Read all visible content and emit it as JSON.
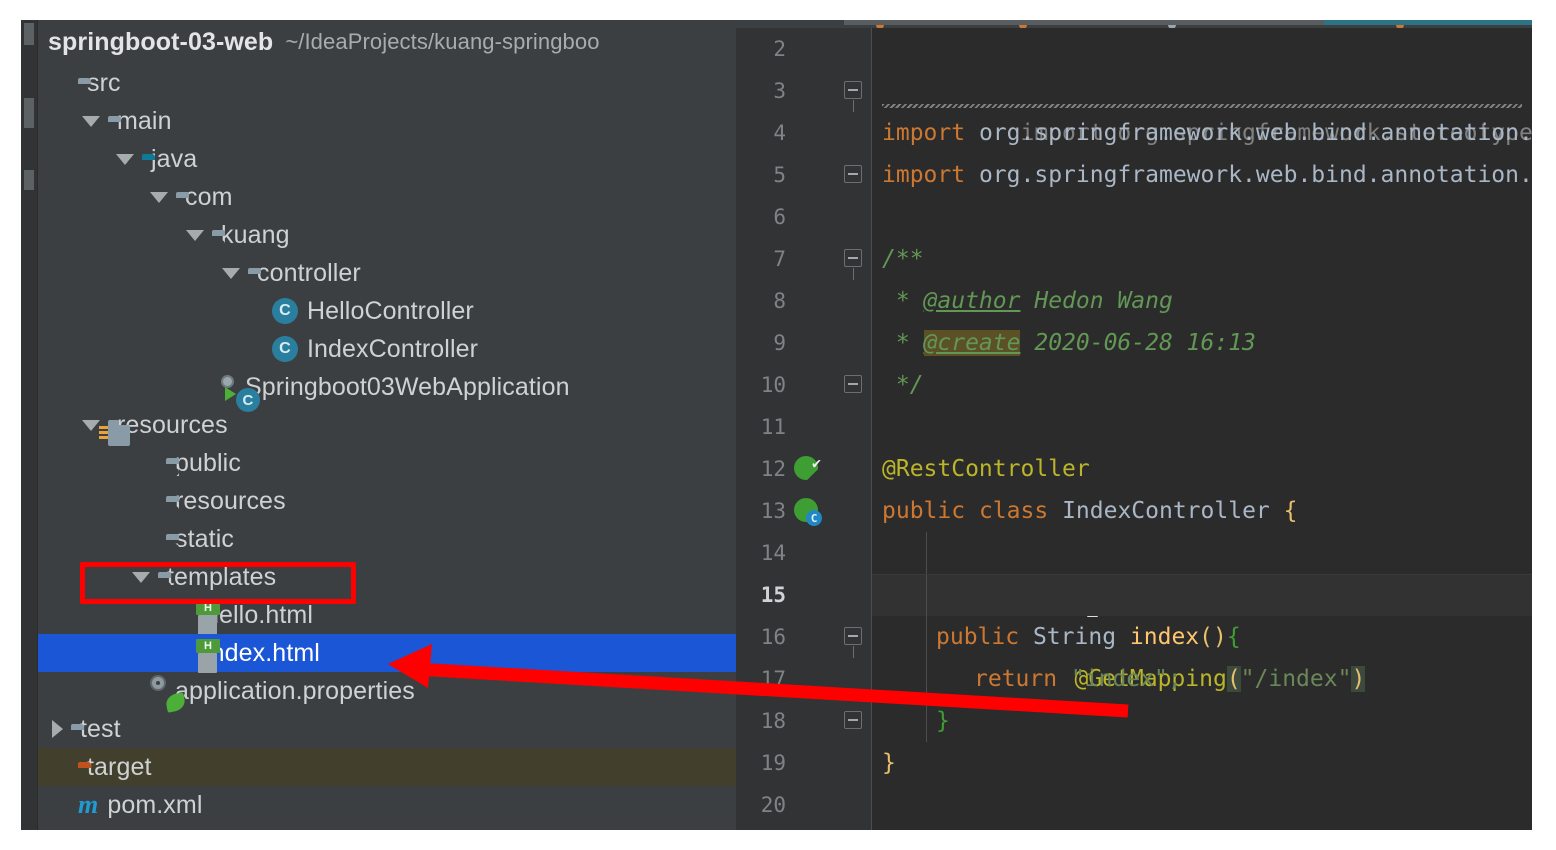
{
  "ide": {
    "theme_bg": "#3c3f41",
    "editor_bg": "#2b2b2b",
    "selection_color": "#1a56d6",
    "annotation_color": "#ff0000"
  },
  "project_panel": {
    "project_name": "springboot-03-web",
    "project_path": "~/IdeaProjects/kuang-springboo",
    "tree": [
      {
        "label": "src",
        "icon": "folder-icon",
        "indent": 0,
        "arrow": "none",
        "state": "normal"
      },
      {
        "label": "main",
        "icon": "folder-icon",
        "indent": 1,
        "arrow": "expanded",
        "state": "normal"
      },
      {
        "label": "java",
        "icon": "source-folder-icon",
        "indent": 2,
        "arrow": "expanded",
        "state": "normal"
      },
      {
        "label": "com",
        "icon": "package-icon",
        "indent": 3,
        "arrow": "expanded",
        "state": "normal"
      },
      {
        "label": "kuang",
        "icon": "package-icon",
        "indent": 4,
        "arrow": "expanded",
        "state": "normal"
      },
      {
        "label": "controller",
        "icon": "package-icon",
        "indent": 5,
        "arrow": "expanded",
        "state": "normal"
      },
      {
        "label": "HelloController",
        "icon": "java-class-icon",
        "indent": 6,
        "arrow": "none",
        "state": "normal"
      },
      {
        "label": "IndexController",
        "icon": "java-class-icon",
        "indent": 6,
        "arrow": "none",
        "state": "normal"
      },
      {
        "label": "Springboot03WebApplication",
        "icon": "spring-boot-app-icon",
        "indent": 5,
        "arrow": "none",
        "state": "normal"
      },
      {
        "label": "resources",
        "icon": "resources-folder-icon",
        "indent": 2,
        "arrow": "expanded",
        "state": "normal"
      },
      {
        "label": "public",
        "icon": "package-icon",
        "indent": 3,
        "arrow": "none",
        "state": "normal"
      },
      {
        "label": "resources",
        "icon": "package-icon",
        "indent": 3,
        "arrow": "none",
        "state": "normal"
      },
      {
        "label": "static",
        "icon": "package-icon",
        "indent": 3,
        "arrow": "none",
        "state": "normal"
      },
      {
        "label": "templates",
        "icon": "package-icon",
        "indent": 3,
        "arrow": "expanded",
        "state": "highlighted"
      },
      {
        "label": "hello.html",
        "icon": "html-file-icon",
        "indent": 4,
        "arrow": "none",
        "state": "normal"
      },
      {
        "label": "index.html",
        "icon": "html-file-icon",
        "indent": 4,
        "arrow": "none",
        "state": "selected"
      },
      {
        "label": "application.properties",
        "icon": "spring-properties-icon",
        "indent": 3,
        "arrow": "none",
        "state": "normal"
      },
      {
        "label": "test",
        "icon": "folder-icon",
        "indent": 1,
        "arrow": "collapsed",
        "state": "normal"
      },
      {
        "label": "target",
        "icon": "excluded-folder-icon",
        "indent": 0,
        "arrow": "none",
        "state": "excluded"
      },
      {
        "label": "pom.xml",
        "icon": "maven-icon",
        "indent": 0,
        "arrow": "none",
        "state": "normal"
      }
    ]
  },
  "editor": {
    "current_line": 15,
    "lines": [
      {
        "num": 2,
        "gutter": "",
        "fold": "",
        "text": ""
      },
      {
        "num": 3,
        "gutter": "",
        "fold": "top",
        "text": "import org.springframework.stereotype.Controller",
        "style": "unused-import"
      },
      {
        "num": 4,
        "gutter": "",
        "fold": "",
        "text": "import org.springframework.web.bind.annotation.G"
      },
      {
        "num": 5,
        "gutter": "",
        "fold": "end",
        "text": "import org.springframework.web.bind.annotation.R"
      },
      {
        "num": 6,
        "gutter": "",
        "fold": "",
        "text": ""
      },
      {
        "num": 7,
        "gutter": "",
        "fold": "top",
        "text": "/**"
      },
      {
        "num": 8,
        "gutter": "",
        "fold": "",
        "text": " * @author Hedon Wang"
      },
      {
        "num": 9,
        "gutter": "",
        "fold": "",
        "text": " * @create 2020-06-28 16:13"
      },
      {
        "num": 10,
        "gutter": "",
        "fold": "end",
        "text": " */"
      },
      {
        "num": 11,
        "gutter": "",
        "fold": "",
        "text": ""
      },
      {
        "num": 12,
        "gutter": "bean-check-icon",
        "fold": "",
        "text": "@RestController"
      },
      {
        "num": 13,
        "gutter": "bean-class-icon",
        "fold": "",
        "text": "public class IndexController {"
      },
      {
        "num": 14,
        "gutter": "",
        "fold": "",
        "text": "",
        "inline_icon": "lightbulb-icon"
      },
      {
        "num": 15,
        "gutter": "",
        "fold": "",
        "text": "    @GetMapping(\"/index\")"
      },
      {
        "num": 16,
        "gutter": "",
        "fold": "top",
        "text": "    public String index(){"
      },
      {
        "num": 17,
        "gutter": "",
        "fold": "",
        "text": "        return \"index\";"
      },
      {
        "num": 18,
        "gutter": "",
        "fold": "end",
        "text": "    }"
      },
      {
        "num": 19,
        "gutter": "",
        "fold": "",
        "text": "}"
      },
      {
        "num": 20,
        "gutter": "",
        "fold": "",
        "text": ""
      }
    ],
    "tokens": {
      "import_kw": "import",
      "package_g": "org.springframework.web.bind.annotation.",
      "author_tag": "@author",
      "author_name": "Hedon Wang",
      "create_tag": "@create",
      "create_date": "2020-06-28 16:13",
      "rest_controller": "@RestController",
      "get_mapping": "@GetMapping",
      "index_path": "\"/index\"",
      "return_value": "\"index\";"
    }
  },
  "annotations": {
    "highlight_box_target": "templates",
    "arrow_points_to": "index.html"
  }
}
